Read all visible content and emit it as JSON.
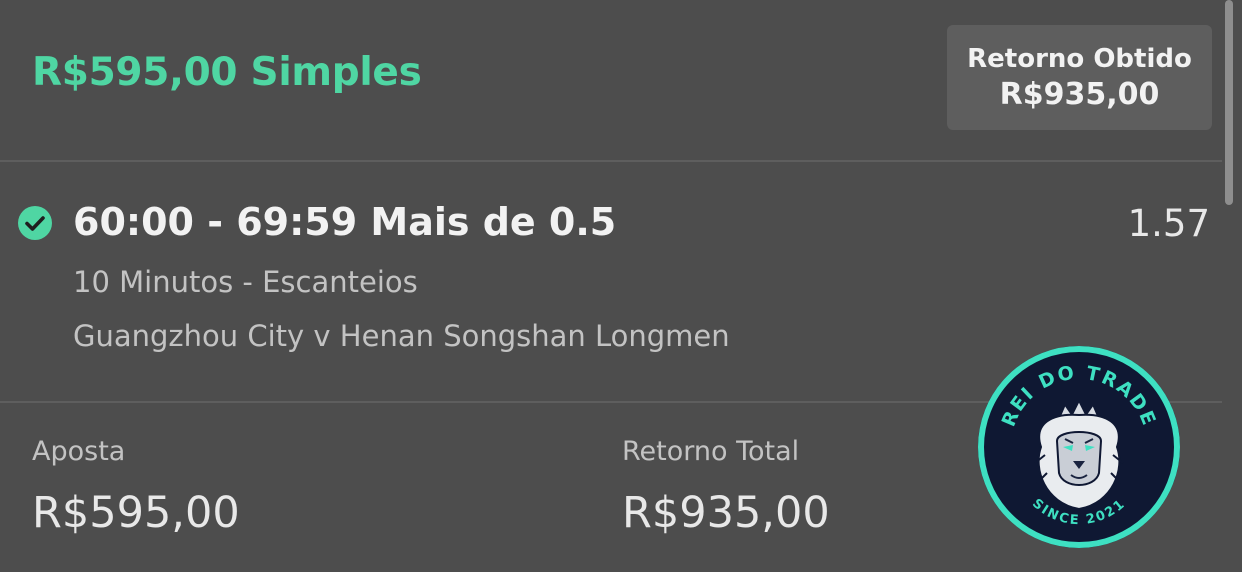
{
  "bet": {
    "title": "R$595,00 Simples",
    "returned_label": "Retorno Obtido",
    "returned_value": "R$935,00"
  },
  "selection": {
    "status": "won",
    "status_icon": "check-circle-icon",
    "name": "60:00 - 69:59 Mais de 0.5",
    "odds": "1.57",
    "market": "10 Minutos - Escanteios",
    "event": "Guangzhou City v Henan Songshan Longmen"
  },
  "footer": {
    "stake_label": "Aposta",
    "stake_value": "R$595,00",
    "total_return_label": "Retorno Total",
    "total_return_value": "R$935,00"
  },
  "watermark": {
    "text_top": "REI DO TRADE",
    "text_bottom": "SINCE 2021"
  },
  "colors": {
    "background": "#4d4d4d",
    "accent": "#4fd6a3",
    "panel": "#5e5e5e",
    "logo_ring": "#3ee0c2",
    "logo_bg": "#0f1833"
  }
}
